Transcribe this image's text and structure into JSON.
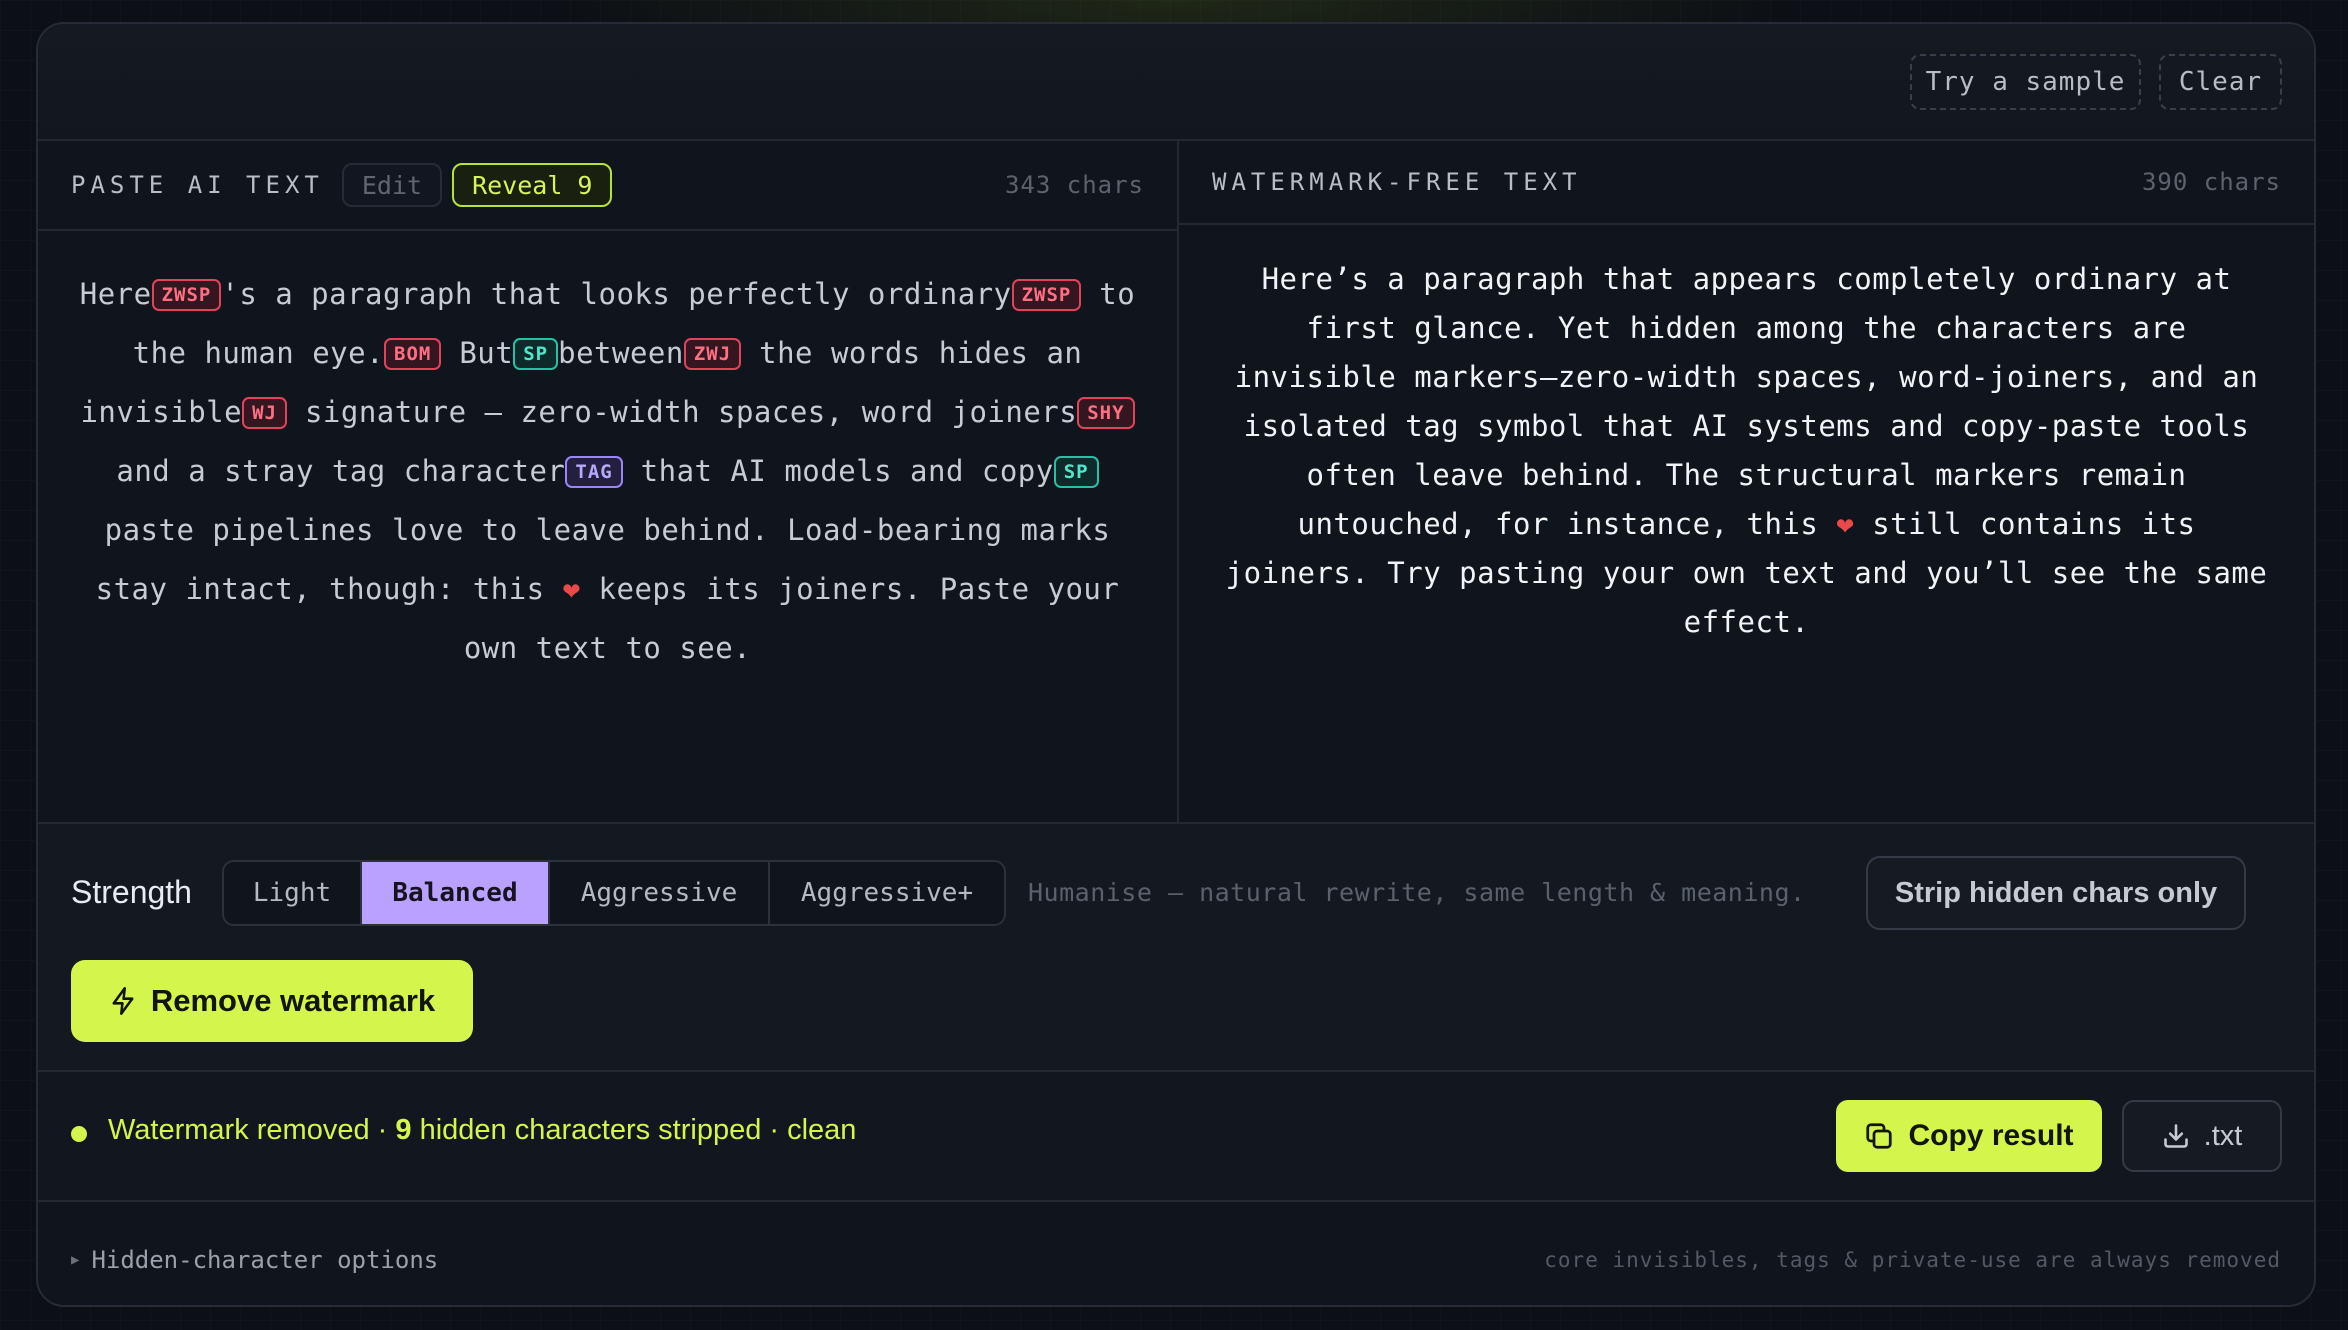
{
  "toolbar": {
    "sample_label": "Try a sample",
    "clear_label": "Clear"
  },
  "input_pane": {
    "title": "PASTE AI TEXT",
    "mode_edit": "Edit",
    "mode_reveal": "Reveal 9",
    "char_count": "343 chars",
    "segments": [
      {
        "t": "text",
        "v": "Here"
      },
      {
        "t": "tag",
        "v": "ZWSP",
        "c": "red"
      },
      {
        "t": "text",
        "v": "'s a paragraph that looks perfectly ordinary"
      },
      {
        "t": "tag",
        "v": "ZWSP",
        "c": "red"
      },
      {
        "t": "text",
        "v": " to the human eye."
      },
      {
        "t": "tag",
        "v": "BOM",
        "c": "red"
      },
      {
        "t": "text",
        "v": " But"
      },
      {
        "t": "tag",
        "v": "SP",
        "c": "teal"
      },
      {
        "t": "text",
        "v": "between"
      },
      {
        "t": "tag",
        "v": "ZWJ",
        "c": "red"
      },
      {
        "t": "text",
        "v": " the words hides an invisible"
      },
      {
        "t": "tag",
        "v": "WJ",
        "c": "red"
      },
      {
        "t": "text",
        "v": " signature — zero-width spaces, word joiners"
      },
      {
        "t": "tag",
        "v": "SHY",
        "c": "red"
      },
      {
        "t": "text",
        "v": " and a stray tag character"
      },
      {
        "t": "tag",
        "v": "TAG",
        "c": "purple"
      },
      {
        "t": "text",
        "v": " that AI models and copy"
      },
      {
        "t": "tag",
        "v": "SP",
        "c": "teal"
      },
      {
        "t": "text",
        "v": "paste pipelines love to leave behind. Load-bearing marks stay intact, though: this "
      },
      {
        "t": "emoji",
        "v": "❤"
      },
      {
        "t": "text",
        "v": " keeps its joiners. Paste your own text to see."
      }
    ]
  },
  "output_pane": {
    "title": "WATERMARK-FREE TEXT",
    "char_count": "390 chars",
    "text_before_emoji": "Here’s a paragraph that appears completely ordinary at first glance. Yet hidden among the characters are invisible markers—zero-width spaces, word-joiners, and an isolated tag symbol that AI systems and copy-paste tools often leave behind. The structural markers remain untouched, for instance, this ",
    "emoji": "❤",
    "text_after_emoji": " still contains its joiners. Try pasting your own text and you’ll see the same effect."
  },
  "controls": {
    "strength_label": "Strength",
    "options": [
      "Light",
      "Balanced",
      "Aggressive",
      "Aggressive+"
    ],
    "selected": "Balanced",
    "hint": "Humanise — natural rewrite, same length & meaning.",
    "strip_label": "Strip hidden chars only",
    "remove_label": "Remove watermark",
    "remove_icon": "lightning-icon"
  },
  "status": {
    "prefix": "Watermark removed · ",
    "count": "9",
    "suffix": " hidden characters stripped · clean",
    "accent_color": "#d4f54b",
    "copy_label": "Copy result",
    "copy_icon": "copy-icon",
    "download_label": ".txt",
    "download_icon": "download-icon"
  },
  "footer": {
    "toggle_label": "Hidden-character options",
    "note": "core invisibles, tags & private-use are always removed"
  }
}
